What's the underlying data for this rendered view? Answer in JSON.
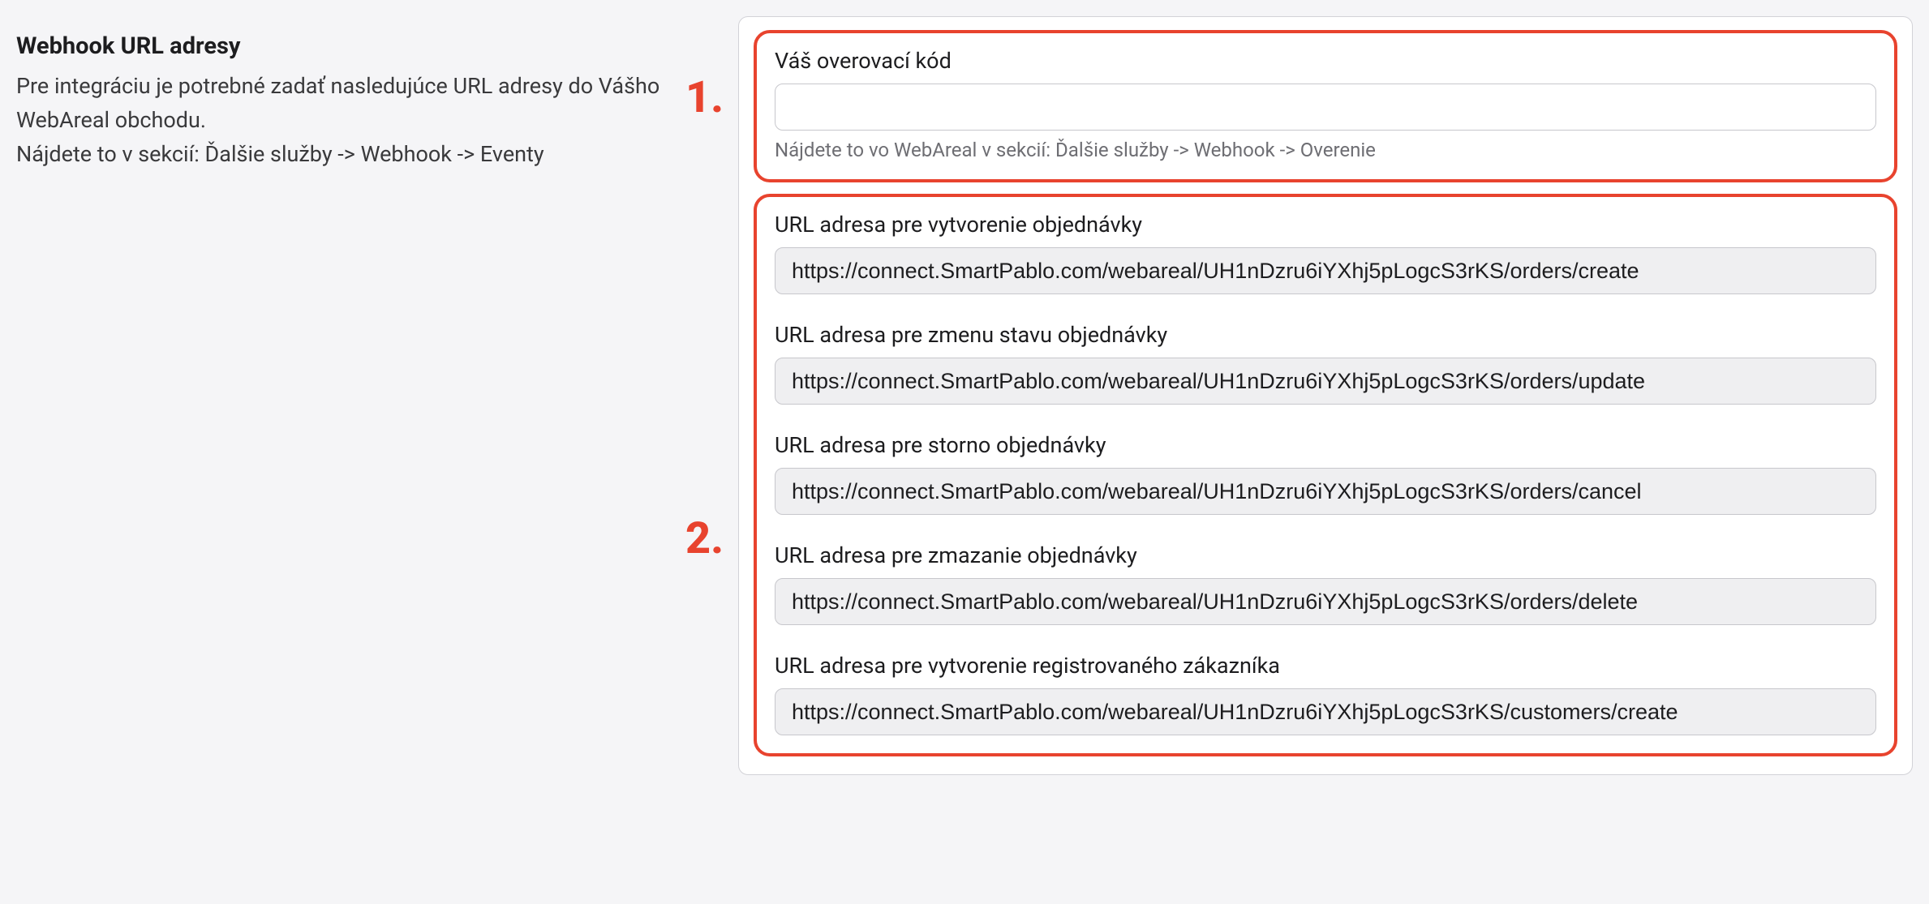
{
  "left": {
    "title": "Webhook URL adresy",
    "desc_line1": "Pre integráciu je potrebné zadať nasledujúce URL adresy do Vášho WebAreal obchodu.",
    "desc_line2": "Nájdete to v sekcií: Ďalšie služby -> Webhook -> Eventy"
  },
  "annotations": {
    "one": "1.",
    "two": "2."
  },
  "verification": {
    "label": "Váš overovací kód",
    "value": "",
    "hint": "Nájdete to vo WebAreal v sekcií: Ďalšie služby -> Webhook -> Overenie"
  },
  "urls": [
    {
      "label": "URL adresa pre vytvorenie objednávky",
      "value": "https://connect.SmartPablo.com/webareal/UH1nDzru6iYXhj5pLogcS3rKS/orders/create"
    },
    {
      "label": "URL adresa pre zmenu stavu objednávky",
      "value": "https://connect.SmartPablo.com/webareal/UH1nDzru6iYXhj5pLogcS3rKS/orders/update"
    },
    {
      "label": "URL adresa pre storno objednávky",
      "value": "https://connect.SmartPablo.com/webareal/UH1nDzru6iYXhj5pLogcS3rKS/orders/cancel"
    },
    {
      "label": "URL adresa pre zmazanie objednávky",
      "value": "https://connect.SmartPablo.com/webareal/UH1nDzru6iYXhj5pLogcS3rKS/orders/delete"
    },
    {
      "label": "URL adresa pre vytvorenie registrovaného zákazníka",
      "value": "https://connect.SmartPablo.com/webareal/UH1nDzru6iYXhj5pLogcS3rKS/customers/create"
    }
  ]
}
